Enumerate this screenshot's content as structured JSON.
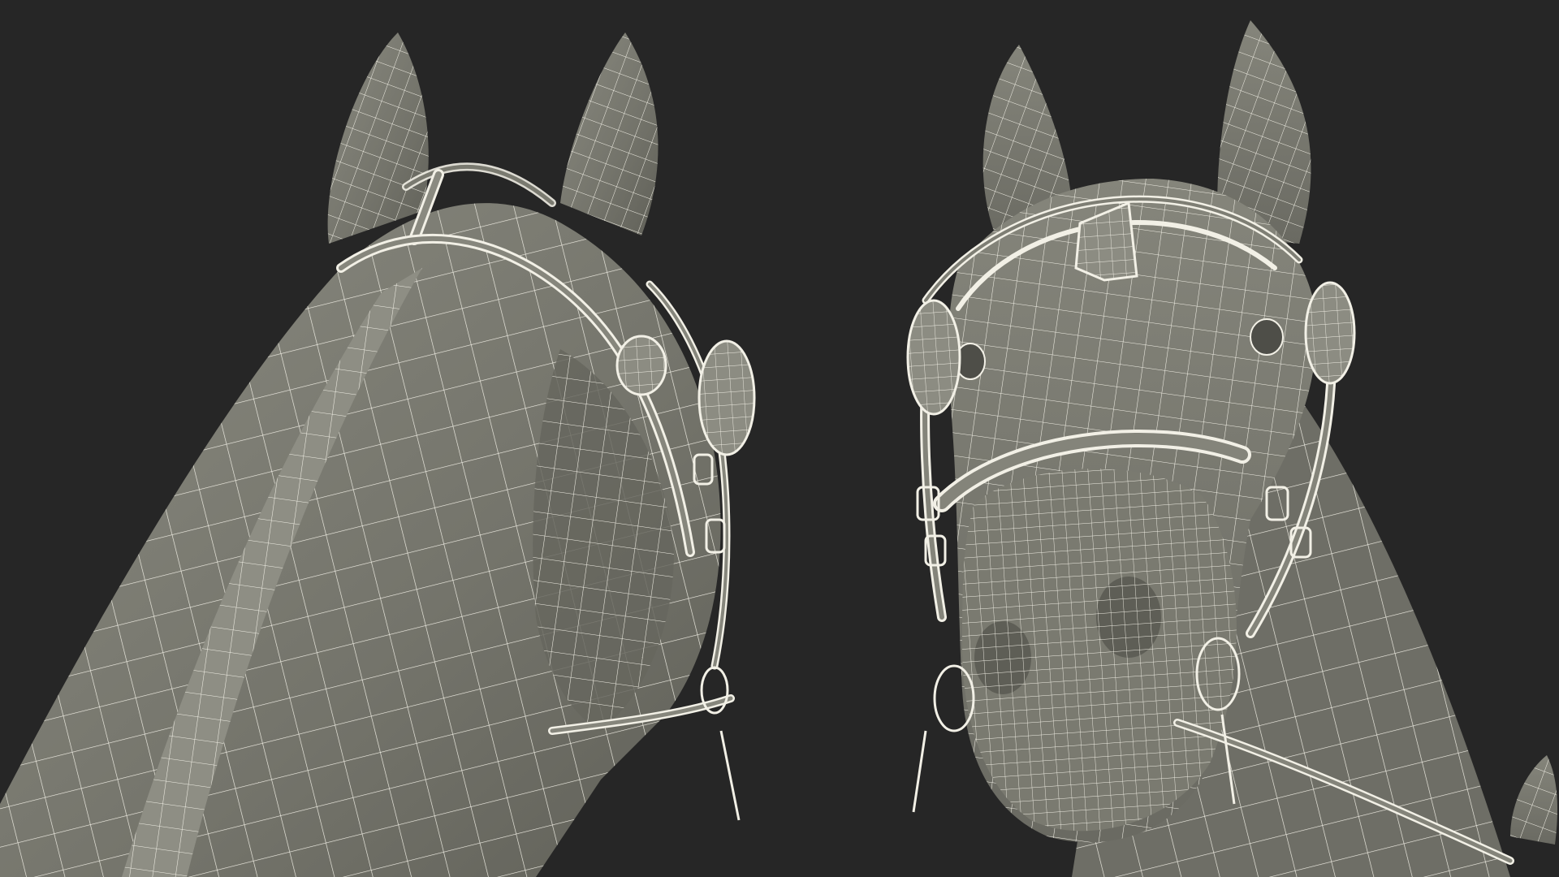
{
  "scene": {
    "background_color": "#262626",
    "surface_color": "#7a7a70",
    "surface_shadow_color": "#5e5e56",
    "surface_light_color": "#9a9a8e",
    "wire_color": "#f2f0e6",
    "views": [
      {
        "subject": "horse-head-bridle-wireframe-side-view"
      },
      {
        "subject": "horse-head-bridle-wireframe-front-view"
      }
    ]
  }
}
